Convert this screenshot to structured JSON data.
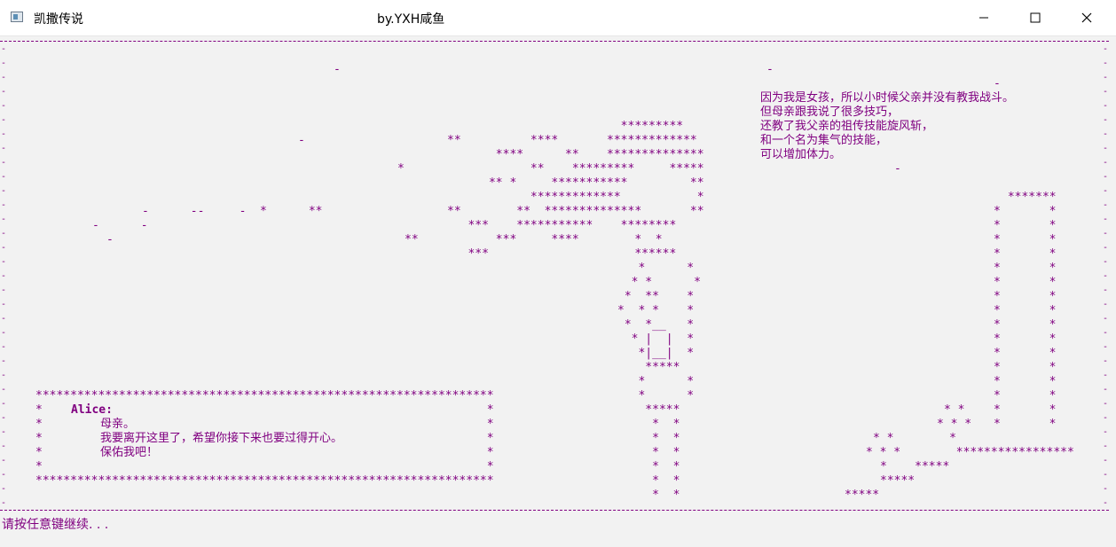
{
  "window": {
    "title": "凯撒传说",
    "subtitle": "by.YXH咸鱼",
    "minimize_label": "Minimize",
    "maximize_label": "Maximize",
    "close_label": "Close"
  },
  "narration": {
    "lines": [
      "因为我是女孩，所以小时候父亲并没有教我战斗。",
      "但母亲跟我说了很多技巧，",
      "还教了我父亲的祖传技能旋风斩，",
      "和一个名为集气的技能，",
      "可以增加体力。"
    ]
  },
  "dialog": {
    "speaker": "Alice:",
    "lines": [
      "母亲。",
      "我要离开这里了，希望你接下来也要过得开心。",
      "保佑我吧！"
    ]
  },
  "prompt": "请按任意键继续. . .",
  "colors": {
    "console_text": "#800080",
    "background": "#f2f2f2"
  }
}
